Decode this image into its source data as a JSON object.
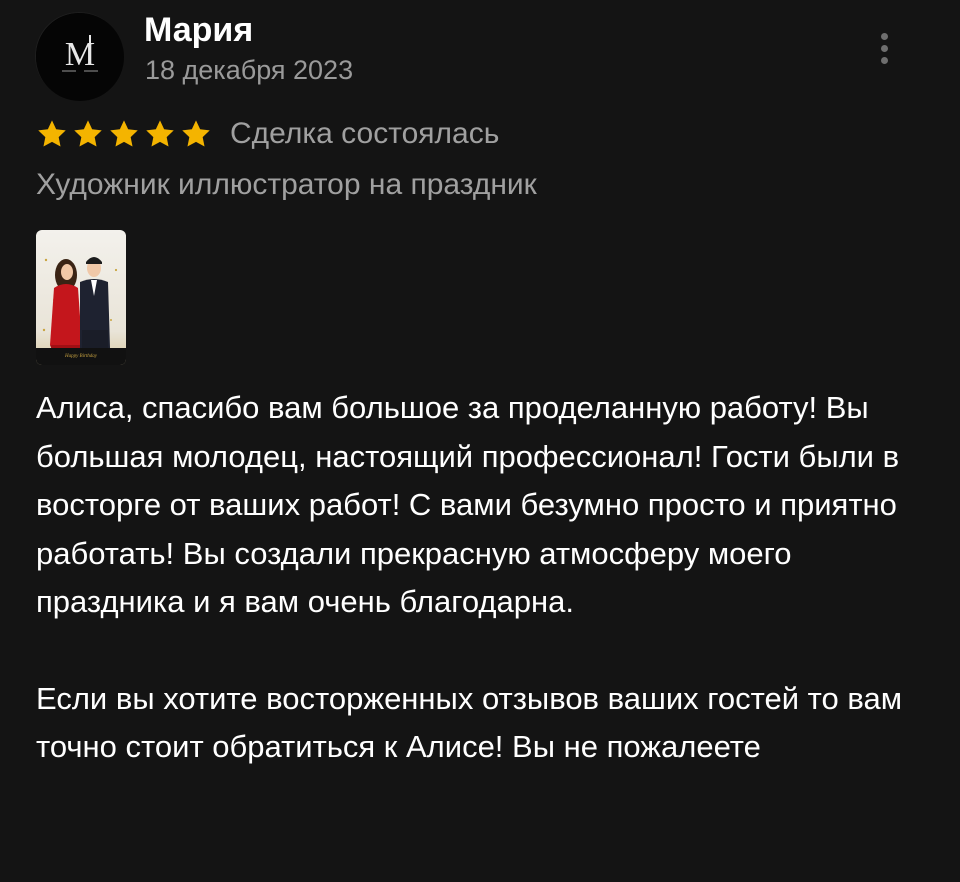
{
  "review": {
    "author": {
      "name": "Мария",
      "avatar_icon": "monogram-logo-icon",
      "avatar_letter": "M"
    },
    "date": "18 декабря 2023",
    "menu_icon": "more-vertical-icon",
    "rating": 5,
    "star_color": "#f4b400",
    "deal_status": "Сделка состоялась",
    "service": "Художник иллюстратор на праздник",
    "photos": [
      {
        "alt_icon": "portrait-illustration-icon"
      }
    ],
    "text_paragraphs": [
      "Алиса, спасибо вам большое за проделанную работу! Вы большая молодец, настоящий профессионал! Гости были в восторге от ваших работ! С вами безумно просто и приятно работать! Вы создали прекрасную атмосферу моего праздника и я вам очень благодарна.",
      "Если вы хотите восторженных отзывов ваших гостей то вам точно стоит обратиться к Алисе! Вы не пожалеете"
    ]
  },
  "colors": {
    "background": "#141414",
    "primary_text": "#ffffff",
    "secondary_text": "#a0a0a0",
    "star": "#f4b400"
  }
}
